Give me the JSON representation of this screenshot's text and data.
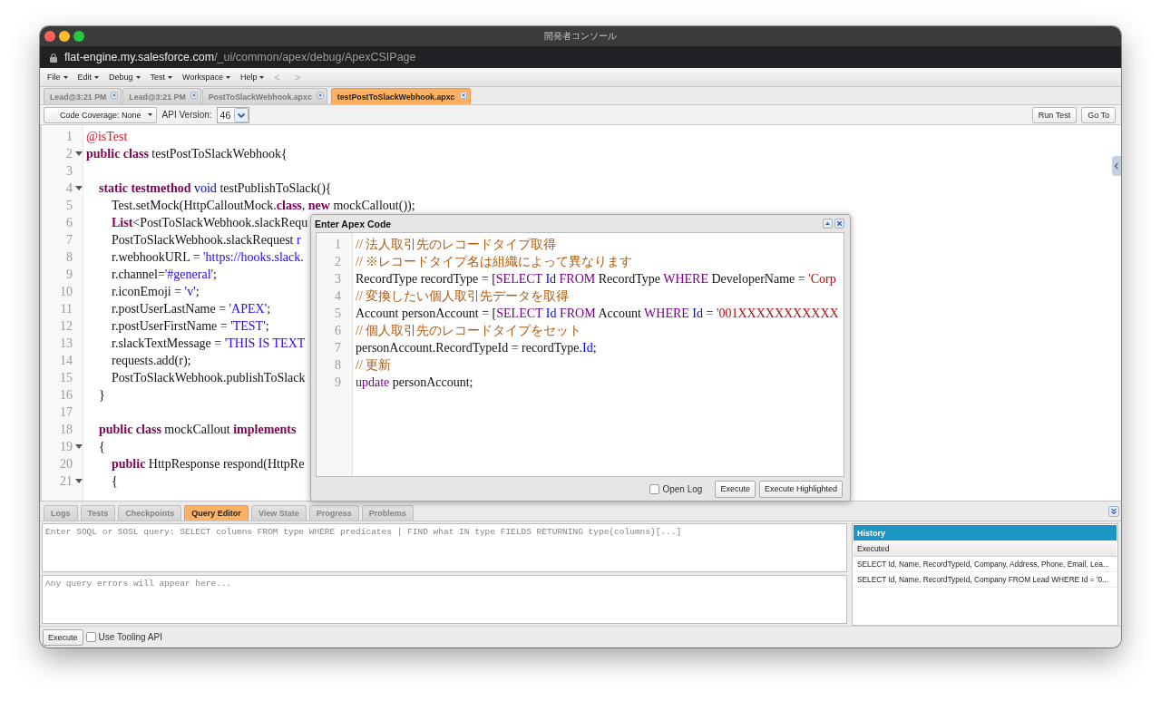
{
  "window": {
    "title": "開発者コンソール"
  },
  "address_bar": {
    "domain": "flat-engine.my.salesforce.com",
    "path": "/_ui/common/apex/debug/ApexCSIPage"
  },
  "menu": [
    "File",
    "Edit",
    "Debug",
    "Test",
    "Workspace",
    "Help"
  ],
  "nav_arrows": [
    {
      "label": "<",
      "disabled": true
    },
    {
      "label": ">",
      "disabled": true
    }
  ],
  "tabs": [
    {
      "label": "Lead@3:21 PM",
      "selected": false
    },
    {
      "label": "Lead@3:21 PM",
      "selected": false
    },
    {
      "label": "PostToSlackWebhook.apxc",
      "selected": false
    },
    {
      "label": "testPostToSlackWebhook.apxc",
      "selected": true
    }
  ],
  "toolbar": {
    "coverage": "Code Coverage: None",
    "api_label": "API Version:",
    "api_version": "46",
    "buttons": [
      "Run Test",
      "Go To"
    ]
  },
  "editor": {
    "lines": [
      {
        "number": "1",
        "foldable": false,
        "tokens": [
          {
            "kind": "annotation",
            "text": "@isTest"
          }
        ]
      },
      {
        "number": "2",
        "foldable": true,
        "tokens": [
          {
            "kind": "keyword",
            "text": "public class"
          },
          {
            "kind": "plain",
            "text": " testPostToSlackWebhook{"
          }
        ],
        "children": [
          {
            "number": "3",
            "foldable": false
          },
          {
            "number": "4",
            "foldable": true,
            "tokens": [
              {
                "kind": "keyword",
                "text": "static testmethod"
              },
              {
                "kind": "type",
                "text": " void"
              },
              {
                "kind": "plain",
                "text": " testPublishToSlack(){"
              }
            ],
            "children": [
              {
                "number": "5",
                "foldable": false,
                "tokens": [
                  {
                    "kind": "plain",
                    "text": "Test.setMock(HttpCalloutMock."
                  },
                  {
                    "kind": "keyword",
                    "text": "class"
                  },
                  {
                    "kind": "plain",
                    "text": ", "
                  },
                  {
                    "kind": "keyword",
                    "text": "new"
                  },
                  {
                    "kind": "plain",
                    "text": " mockCallout());"
                  }
                ]
              },
              {
                "number": "6",
                "foldable": false,
                "tokens": [
                  {
                    "kind": "keyword",
                    "text": "List"
                  },
                  {
                    "kind": "plain",
                    "text": "<PostToSlackWebhook.slackRequ"
                  }
                ]
              },
              {
                "number": "7",
                "foldable": false,
                "tokens": [
                  {
                    "kind": "plain",
                    "text": "PostToSlackWebhook.slackRequest "
                  },
                  {
                    "kind": "variable",
                    "text": "r"
                  }
                ]
              },
              {
                "number": "8",
                "foldable": false,
                "tokens": [
                  {
                    "kind": "plain",
                    "text": "r.webhookURL = "
                  },
                  {
                    "kind": "string",
                    "text": "'https://hooks.slack."
                  }
                ]
              },
              {
                "number": "9",
                "foldable": false,
                "tokens": [
                  {
                    "kind": "plain",
                    "text": "r.channel="
                  },
                  {
                    "kind": "string",
                    "text": "'#general'"
                  },
                  {
                    "kind": "plain",
                    "text": ";"
                  }
                ]
              },
              {
                "number": "10",
                "foldable": false,
                "tokens": [
                  {
                    "kind": "plain",
                    "text": "r.iconEmoji = "
                  },
                  {
                    "kind": "string",
                    "text": "'v'"
                  },
                  {
                    "kind": "plain",
                    "text": ";"
                  }
                ]
              },
              {
                "number": "11",
                "foldable": false,
                "tokens": [
                  {
                    "kind": "plain",
                    "text": "r.postUserLastName = "
                  },
                  {
                    "kind": "string",
                    "text": "'APEX'"
                  },
                  {
                    "kind": "plain",
                    "text": ";"
                  }
                ]
              },
              {
                "number": "12",
                "foldable": false,
                "tokens": [
                  {
                    "kind": "plain",
                    "text": "r.postUserFirstName = "
                  },
                  {
                    "kind": "string",
                    "text": "'TEST'"
                  },
                  {
                    "kind": "plain",
                    "text": ";"
                  }
                ]
              },
              {
                "number": "13",
                "foldable": false,
                "tokens": [
                  {
                    "kind": "plain",
                    "text": "r.slackTextMessage = "
                  },
                  {
                    "kind": "string",
                    "text": "'THIS IS TEXT"
                  }
                ]
              },
              {
                "number": "14",
                "foldable": false,
                "tokens": [
                  {
                    "kind": "plain",
                    "text": "requests.add(r);"
                  }
                ]
              },
              {
                "number": "15",
                "foldable": false,
                "tokens": [
                  {
                    "kind": "plain",
                    "text": "PostToSlackWebhook.publishToSlack"
                  }
                ]
              }
            ]
          },
          {
            "number": "16",
            "foldable": false,
            "tokens": [
              {
                "kind": "plain",
                "text": "}"
              }
            ]
          },
          {
            "number": "17",
            "foldable": false
          },
          {
            "number": "18",
            "foldable": false,
            "tokens": [
              {
                "kind": "keyword",
                "text": "public class"
              },
              {
                "kind": "plain",
                "text": " mockCallout "
              },
              {
                "kind": "keyword",
                "text": "implements"
              }
            ]
          },
          {
            "number": "19",
            "foldable": true,
            "tokens": [
              {
                "kind": "plain",
                "text": "{"
              }
            ],
            "children": [
              {
                "number": "20",
                "foldable": false,
                "tokens": [
                  {
                    "kind": "keyword",
                    "text": "public"
                  },
                  {
                    "kind": "plain",
                    "text": " HttpResponse respond(HttpRe"
                  }
                ]
              },
              {
                "number": "21",
                "foldable": true,
                "tokens": [
                  {
                    "kind": "plain",
                    "text": "{"
                  }
                ]
              }
            ]
          }
        ]
      }
    ]
  },
  "dialog": {
    "title": "Enter Apex Code",
    "lines": [
      {
        "number": "1",
        "tokens": [
          {
            "kind": "comment",
            "text": "// 法人取引先のレコードタイプ取得"
          }
        ]
      },
      {
        "number": "2",
        "tokens": [
          {
            "kind": "comment",
            "text": "// ※レコードタイプ名は組織によって異なります"
          }
        ]
      },
      {
        "number": "3",
        "tokens": [
          {
            "kind": "plain",
            "text": "RecordType recordType = ["
          },
          {
            "kind": "keyword",
            "text": "SELECT"
          },
          {
            "kind": "field",
            "text": " Id"
          },
          {
            "kind": "keyword",
            "text": " FROM"
          },
          {
            "kind": "plain",
            "text": " RecordType "
          },
          {
            "kind": "keyword",
            "text": "WHERE"
          },
          {
            "kind": "plain",
            "text": " DeveloperName = "
          },
          {
            "kind": "string",
            "text": "'Corp"
          }
        ]
      },
      {
        "number": "4",
        "tokens": [
          {
            "kind": "comment",
            "text": "// 変換したい個人取引先データを取得"
          }
        ]
      },
      {
        "number": "5",
        "tokens": [
          {
            "kind": "plain",
            "text": "Account personAccount = ["
          },
          {
            "kind": "keyword",
            "text": "SELECT"
          },
          {
            "kind": "field",
            "text": " Id"
          },
          {
            "kind": "keyword",
            "text": " FROM"
          },
          {
            "kind": "plain",
            "text": " Account "
          },
          {
            "kind": "keyword",
            "text": "WHERE"
          },
          {
            "kind": "field",
            "text": " Id"
          },
          {
            "kind": "plain",
            "text": " = "
          },
          {
            "kind": "string",
            "text": "'001XXXXXXXXXXX"
          }
        ]
      },
      {
        "number": "6",
        "tokens": [
          {
            "kind": "comment",
            "text": "// 個人取引先のレコードタイプをセット"
          }
        ]
      },
      {
        "number": "7",
        "tokens": [
          {
            "kind": "plain",
            "text": "personAccount.RecordTypeId = recordType."
          },
          {
            "kind": "field",
            "text": "Id"
          },
          {
            "kind": "plain",
            "text": ";"
          }
        ]
      },
      {
        "number": "8",
        "tokens": [
          {
            "kind": "comment",
            "text": "// 更新"
          }
        ]
      },
      {
        "number": "9",
        "tokens": [
          {
            "kind": "keyword",
            "text": "update"
          },
          {
            "kind": "plain",
            "text": " personAccount;"
          }
        ]
      }
    ],
    "open_log": {
      "label": "Open Log",
      "checked": false
    },
    "buttons": [
      "Execute",
      "Execute Highlighted"
    ]
  },
  "panel_tabs": [
    {
      "label": "Logs",
      "selected": false
    },
    {
      "label": "Tests",
      "selected": false
    },
    {
      "label": "Checkpoints",
      "selected": false
    },
    {
      "label": "Query Editor",
      "selected": true
    },
    {
      "label": "View State",
      "selected": false
    },
    {
      "label": "Progress",
      "selected": false
    },
    {
      "label": "Problems",
      "selected": false
    }
  ],
  "query_editor": {
    "query_field": {
      "placeholder": "Enter SOQL or SOSL query: SELECT columns FROM type WHERE predicates | FIND what IN type FIELDS RETURNING type(columns)[...]"
    },
    "errors_field": {
      "placeholder": "Any query errors will appear here..."
    },
    "history": {
      "title": "History",
      "column": "Executed",
      "rows": [
        {
          "text": "SELECT Id, Name, RecordTypeId, Company, Address, Phone, Email, Lea...",
          "selected": false
        },
        {
          "text": "SELECT Id, Name, RecordTypeId, Company FROM Lead WHERE Id = '0...",
          "selected": false
        }
      ]
    },
    "execute": "Execute",
    "tooling": {
      "label": "Use Tooling API",
      "checked": false
    }
  }
}
